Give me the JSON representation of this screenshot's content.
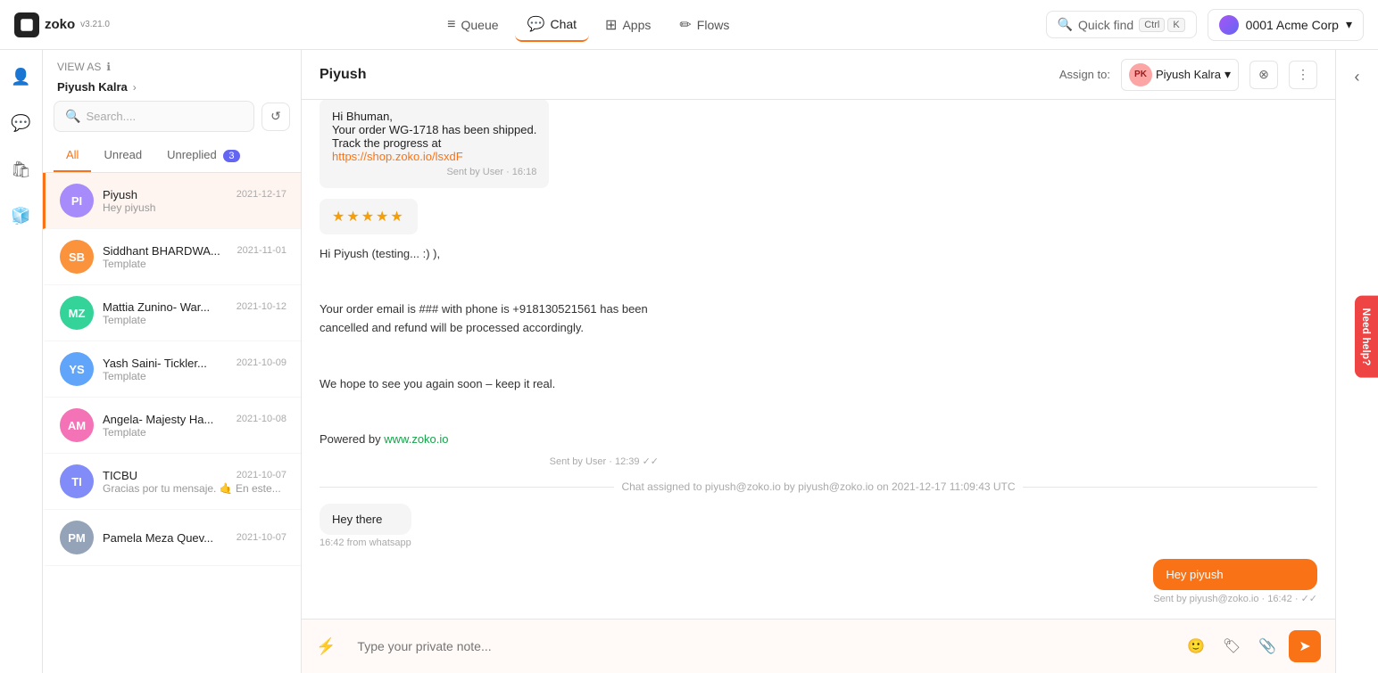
{
  "app": {
    "name": "zoko",
    "version": "v3.21.0"
  },
  "nav": {
    "items": [
      {
        "id": "queue",
        "label": "Queue",
        "icon": "☰",
        "active": false
      },
      {
        "id": "chat",
        "label": "Chat",
        "icon": "💬",
        "active": true
      },
      {
        "id": "apps",
        "label": "Apps",
        "icon": "⚏",
        "active": false
      },
      {
        "id": "flows",
        "label": "Flows",
        "icon": "✏",
        "active": false
      }
    ],
    "quick_find": "Quick find",
    "kbd1": "Ctrl",
    "kbd2": "K",
    "company": "0001 Acme Corp"
  },
  "sidebar": {
    "view_as_label": "VIEW AS",
    "user": "Piyush Kalra",
    "search_placeholder": "Search....",
    "tabs": [
      {
        "id": "all",
        "label": "All",
        "active": true,
        "badge": null
      },
      {
        "id": "unread",
        "label": "Unread",
        "active": false,
        "badge": null
      },
      {
        "id": "unreplied",
        "label": "Unreplied",
        "active": false,
        "badge": "3"
      }
    ],
    "chats": [
      {
        "id": "piyush",
        "name": "Piyush",
        "date": "2021-12-17",
        "preview": "Hey piyush",
        "avatar_initials": "PI",
        "avatar_color": "#a78bfa",
        "active": true
      },
      {
        "id": "siddhant",
        "name": "Siddhant BHARDWA...",
        "date": "2021-11-01",
        "preview": "Template",
        "avatar_initials": "SB",
        "avatar_color": "#fb923c",
        "active": false
      },
      {
        "id": "mattia",
        "name": "Mattia Zunino- War...",
        "date": "2021-10-12",
        "preview": "Template",
        "avatar_initials": "MZ",
        "avatar_color": "#34d399",
        "active": false
      },
      {
        "id": "yash",
        "name": "Yash Saini- Tickler...",
        "date": "2021-10-09",
        "preview": "Template",
        "avatar_initials": "YS",
        "avatar_color": "#60a5fa",
        "active": false
      },
      {
        "id": "angela",
        "name": "Angela- Majesty Ha...",
        "date": "2021-10-08",
        "preview": "Template",
        "avatar_initials": "AM",
        "avatar_color": "#f472b6",
        "active": false
      },
      {
        "id": "ticbu",
        "name": "TICBU",
        "date": "2021-10-07",
        "preview": "Gracias por tu mensaje. 🤙 En este...",
        "avatar_initials": "TI",
        "avatar_color": "#818cf8",
        "active": false
      },
      {
        "id": "pamela",
        "name": "Pamela Meza Quev...",
        "date": "2021-10-07",
        "preview": "",
        "avatar_initials": "PM",
        "avatar_color": "#94a3b8",
        "active": false
      }
    ]
  },
  "chat": {
    "contact_name": "Piyush",
    "assign_to_label": "Assign to:",
    "assignee_initials": "PK",
    "assignee_name": "Piyush Kalra",
    "messages": [
      {
        "id": "msg1",
        "type": "card",
        "direction": "incoming",
        "lines": [
          "Hi Bhuman,",
          "Your order WG-1718 has been shipped.",
          "Track the progress at",
          "https://shop.zoko.io/lsxdF"
        ],
        "link": "https://shop.zoko.io/lsxdF",
        "meta": "Sent by User · 16:18"
      },
      {
        "id": "msg2",
        "type": "stars",
        "direction": "incoming",
        "stars": "★★★★★",
        "meta": ""
      },
      {
        "id": "msg3",
        "type": "text_block",
        "direction": "incoming",
        "text": "Hi Piyush (testing... :) ),\n\nYour order email is ### with phone is +918130521561 has been cancelled and refund will be processed accordingly.\n\nWe hope to see you again soon – keep it real.\n\nPowered by www.zoko.io",
        "link": "www.zoko.io",
        "meta": "Sent by User · 12:39"
      },
      {
        "id": "sys1",
        "type": "system",
        "text": "Chat assigned to piyush@zoko.io by piyush@zoko.io on 2021-12-17 11:09:43 UTC"
      },
      {
        "id": "msg4",
        "type": "bubble",
        "direction": "incoming",
        "text": "Hey there",
        "meta": "16:42 from whatsapp"
      },
      {
        "id": "msg5",
        "type": "bubble",
        "direction": "outgoing",
        "text": "Hey piyush",
        "meta": "Sent by piyush@zoko.io · 16:42 · ✓✓"
      }
    ],
    "input_placeholder": "Type your private note..."
  },
  "need_help": "Need help?"
}
